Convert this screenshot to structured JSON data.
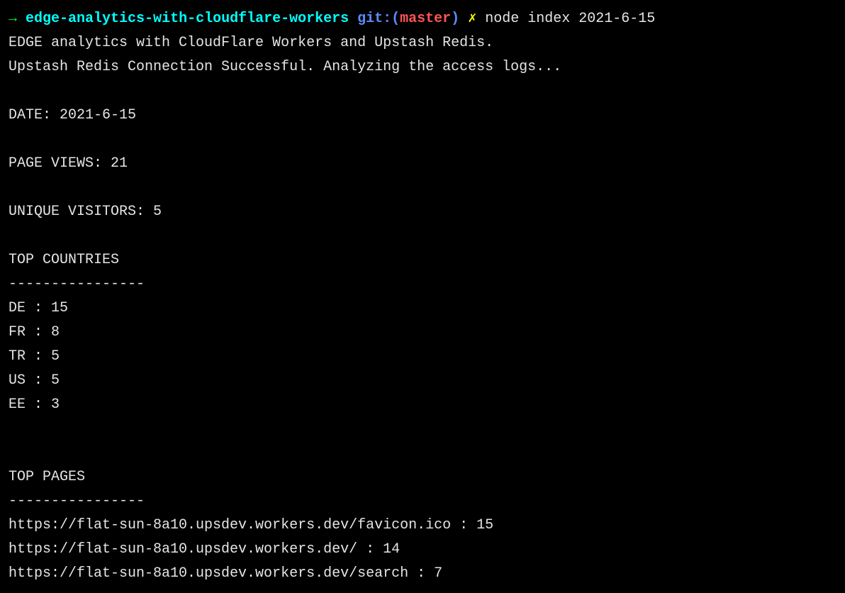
{
  "prompt": {
    "arrow": "→",
    "directory": "edge-analytics-with-cloudflare-workers",
    "git_label": "git:",
    "git_paren_open": "(",
    "git_branch": "master",
    "git_paren_close": ")",
    "dirty_marker": "✗",
    "command": "node index 2021-6-15"
  },
  "output": {
    "line1": "EDGE analytics with CloudFlare Workers and Upstash Redis.",
    "line2": "Upstash Redis Connection Successful. Analyzing the access logs...",
    "date_label": "DATE:",
    "date_value": "2021-6-15",
    "pageviews_label": "PAGE VIEWS:",
    "pageviews_value": "21",
    "unique_visitors_label": "UNIQUE VISITORS:",
    "unique_visitors_value": "5",
    "top_countries_header": "TOP COUNTRIES",
    "divider": "----------------",
    "countries": [
      {
        "code": "DE",
        "count": "15"
      },
      {
        "code": "FR",
        "count": "8"
      },
      {
        "code": "TR",
        "count": "5"
      },
      {
        "code": "US",
        "count": "5"
      },
      {
        "code": "EE",
        "count": "3"
      }
    ],
    "top_pages_header": "TOP PAGES",
    "pages": [
      {
        "url": "https://flat-sun-8a10.upsdev.workers.dev/favicon.ico",
        "count": "15"
      },
      {
        "url": "https://flat-sun-8a10.upsdev.workers.dev/",
        "count": "14"
      },
      {
        "url": "https://flat-sun-8a10.upsdev.workers.dev/search",
        "count": "7"
      }
    ]
  }
}
